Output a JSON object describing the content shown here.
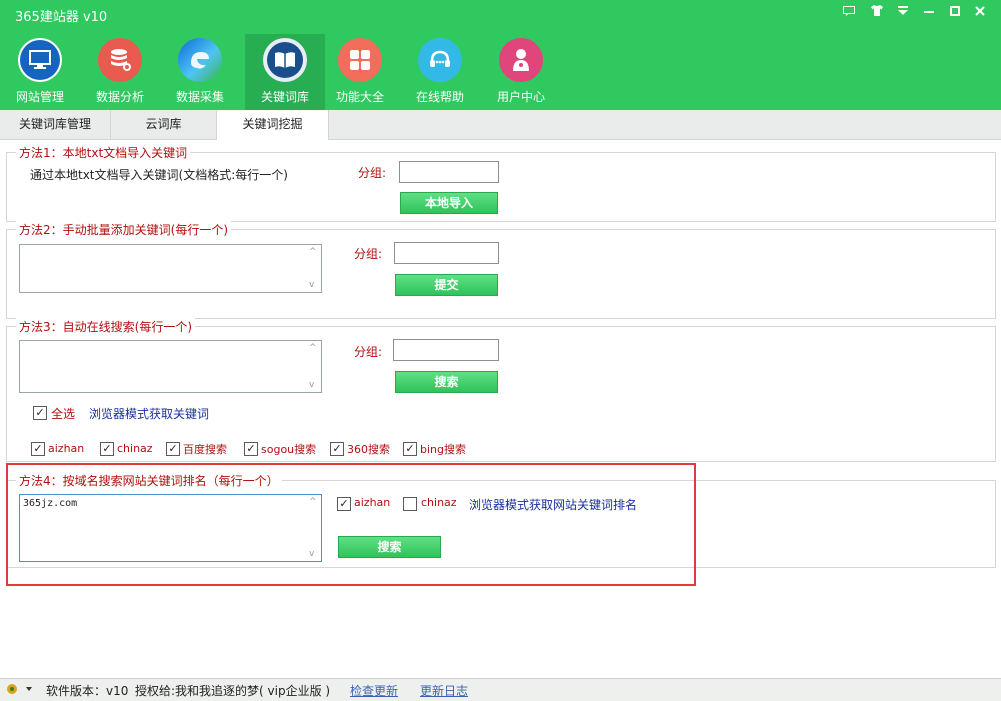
{
  "app": {
    "title": "365建站器 v10",
    "window_controls": [
      "▭",
      "👕",
      "▾",
      "—",
      "□",
      "✕"
    ]
  },
  "nav": [
    {
      "label": "网站管理",
      "icon": "monitor-icon",
      "color": "#1565c0"
    },
    {
      "label": "数据分析",
      "icon": "database-icon",
      "color": "#e95a4f"
    },
    {
      "label": "数据采集",
      "icon": "browser-icon",
      "color": "#1e88e5"
    },
    {
      "label": "关键词库",
      "icon": "book-icon",
      "color": "#1a4f8c"
    },
    {
      "label": "功能大全",
      "icon": "grid-icon",
      "color": "#f26d5b"
    },
    {
      "label": "在线帮助",
      "icon": "headset-icon",
      "color": "#33b9e6"
    },
    {
      "label": "用户中心",
      "icon": "user-icon",
      "color": "#e0457b"
    }
  ],
  "tabs": [
    {
      "label": "关键词库管理",
      "active": false
    },
    {
      "label": "云词库",
      "active": false
    },
    {
      "label": "关键词挖掘",
      "active": true
    }
  ],
  "method1": {
    "legend": "方法1：本地txt文档导入关键词",
    "description": "通过本地txt文档导入关键词(文档格式:每行一个)",
    "group_label": "分组:",
    "group_value": "",
    "button": "本地导入"
  },
  "method2": {
    "legend": "方法2：手动批量添加关键词(每行一个)",
    "textarea_value": "",
    "group_label": "分组:",
    "group_value": "",
    "button": "提交"
  },
  "method3": {
    "legend": "方法3：自动在线搜索(每行一个)",
    "textarea_value": "",
    "group_label": "分组:",
    "group_value": "",
    "button": "搜索",
    "select_all": {
      "label": "全选",
      "checked": true
    },
    "browser_link": "浏览器模式获取关键词",
    "sources": [
      {
        "label": "aizhan",
        "checked": true
      },
      {
        "label": "chinaz",
        "checked": true
      },
      {
        "label": "百度搜索",
        "checked": true
      },
      {
        "label": "sogou搜索",
        "checked": true
      },
      {
        "label": "360搜索",
        "checked": true
      },
      {
        "label": "bing搜索",
        "checked": true
      }
    ]
  },
  "method4": {
    "legend": "方法4：按域名搜索网站关键词排名（每行一个）",
    "textarea_value": "365jz.com",
    "sources": [
      {
        "label": "aizhan",
        "checked": true
      },
      {
        "label": "chinaz",
        "checked": false
      }
    ],
    "browser_link": "浏览器模式获取网站关键词排名",
    "button": "搜索"
  },
  "statusbar": {
    "version": "软件版本：v10",
    "license": "授权给:我和我追逐的梦( vip企业版 )",
    "check_update": "检查更新",
    "changelog": "更新日志"
  },
  "colors": {
    "brand_green": "#2fc95f",
    "active_nav": "#27ad52",
    "legend_red": "#b01010",
    "link_blue": "#1a2f9c",
    "highlight_red": "#e03a3a"
  }
}
